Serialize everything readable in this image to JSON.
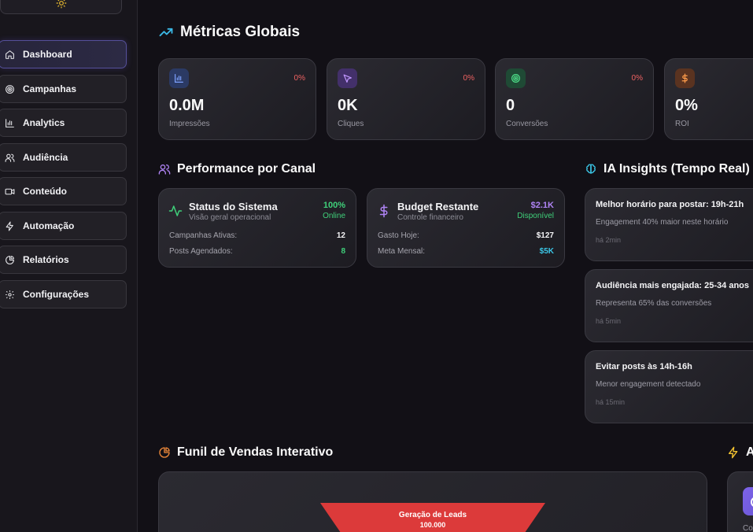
{
  "sidebar": {
    "items": [
      {
        "label": "Dashboard",
        "icon": "home-icon",
        "active": true
      },
      {
        "label": "Campanhas",
        "icon": "target-icon"
      },
      {
        "label": "Analytics",
        "icon": "bar-chart-icon"
      },
      {
        "label": "Audiência",
        "icon": "users-icon"
      },
      {
        "label": "Conteúdo",
        "icon": "video-icon"
      },
      {
        "label": "Automação",
        "icon": "zap-icon"
      },
      {
        "label": "Relatórios",
        "icon": "pie-chart-icon"
      },
      {
        "label": "Configurações",
        "icon": "gear-icon"
      }
    ],
    "theme_icon": "sun-icon"
  },
  "metrics": {
    "title": "Métricas Globais",
    "cards": [
      {
        "value": "0.0M",
        "label": "Impressões",
        "change": "0%",
        "icon": "bar-chart-icon",
        "color": "#5b7fd9"
      },
      {
        "value": "0K",
        "label": "Cliques",
        "change": "0%",
        "icon": "cursor-icon",
        "color": "#a071e8"
      },
      {
        "value": "0",
        "label": "Conversões",
        "change": "0%",
        "icon": "target-icon",
        "color": "#3fc270"
      },
      {
        "value": "0%",
        "label": "ROI",
        "change": "",
        "icon": "dollar-icon",
        "color": "#f08a3a"
      }
    ]
  },
  "performance": {
    "title": "Performance por Canal",
    "status": {
      "title": "Status do Sistema",
      "subtitle": "Visão geral operacional",
      "value": "100%",
      "state": "Online",
      "rows": [
        {
          "label": "Campanhas Ativas:",
          "value": "12"
        },
        {
          "label": "Posts Agendados:",
          "value": "8"
        }
      ]
    },
    "budget": {
      "title": "Budget Restante",
      "subtitle": "Controle financeiro",
      "value": "$2.1K",
      "state": "Disponível",
      "rows": [
        {
          "label": "Gasto Hoje:",
          "value": "$127"
        },
        {
          "label": "Meta Mensal:",
          "value": "$5K"
        }
      ]
    }
  },
  "insights": {
    "title": "IA Insights (Tempo Real)",
    "items": [
      {
        "title": "Melhor horário para postar: 19h-21h",
        "desc": "Engagement 40% maior neste horário",
        "time": "há 2min"
      },
      {
        "title": "Audiência mais engajada: 25-34 anos",
        "desc": "Representa 65% das conversões",
        "time": "há 5min"
      },
      {
        "title": "Evitar posts às 14h-16h",
        "desc": "Menor engagement detectado",
        "time": "há 15min"
      }
    ]
  },
  "funnel": {
    "title": "Funil de Vendas Interativo",
    "stage": {
      "label": "Geração de Leads",
      "value": "100.000"
    }
  },
  "right_panel": {
    "title": "A",
    "card_label": "Co"
  }
}
